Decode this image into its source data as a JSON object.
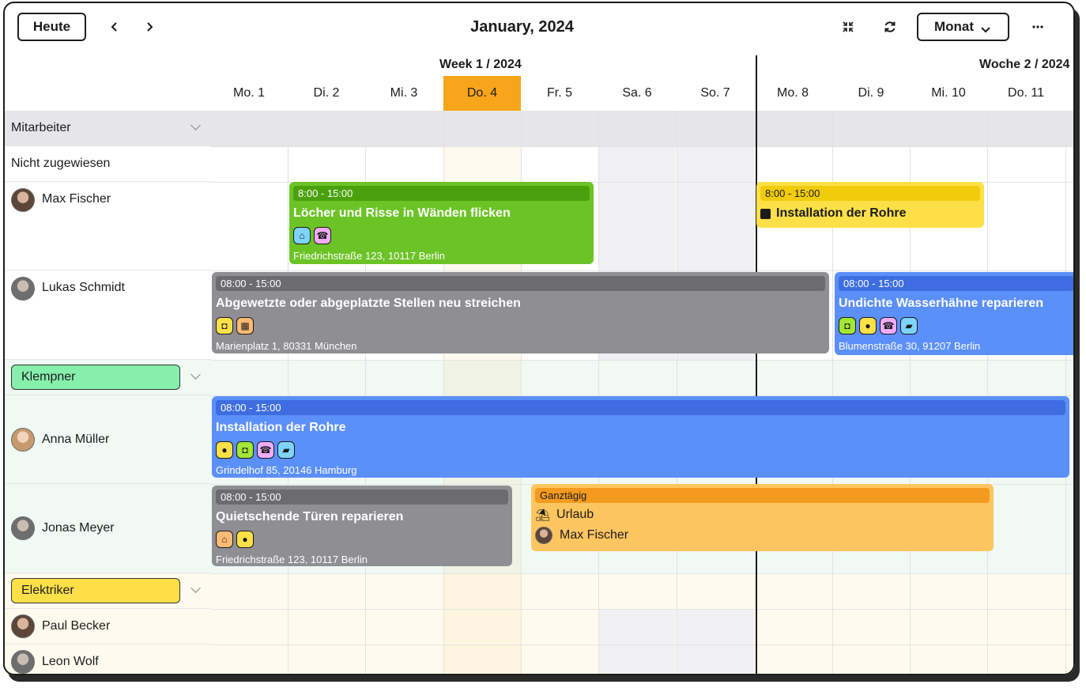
{
  "toolbar": {
    "today_label": "Heute",
    "prev_icon": "chevron-left-icon",
    "next_icon": "chevron-right-icon",
    "title": "January, 2024",
    "collapse_icon": "collapse-arrows-icon",
    "refresh_icon": "refresh-icon",
    "view_label": "Monat",
    "more_icon": "more-horizontal-icon"
  },
  "weeks": [
    {
      "label": "Week 1 / 2024"
    },
    {
      "label": "Woche 2 / 2024"
    }
  ],
  "days": [
    "Mo. 1",
    "Di. 2",
    "Mi. 3",
    "Do. 4",
    "Fr. 5",
    "Sa. 6",
    "So. 7",
    "Mo. 8",
    "Di. 9",
    "Mi. 10",
    "Do. 11"
  ],
  "today_index": 3,
  "rows": {
    "staff_group": "Mitarbeiter",
    "unassigned": "Nicht zugewiesen",
    "max": "Max Fischer",
    "lukas": "Lukas Schmidt",
    "plumber_group": "Klempner",
    "anna": "Anna Müller",
    "jonas": "Jonas Meyer",
    "electrician_group": "Elektriker",
    "paul": "Paul Becker",
    "leon": "Leon Wolf"
  },
  "colors": {
    "today": "#f7a51a",
    "plumber_group": "#86efac",
    "electrician_group": "#fde047",
    "green_event": "#6cc326",
    "gray_event": "#8e8e93",
    "blue_event": "#5b8ff9",
    "yellow_event": "#fde047",
    "orange_event": "#fdc55f"
  },
  "events": {
    "e1": {
      "time": "8:00 - 15:00",
      "title": "Löcher und Risse in Wänden flicken",
      "address": "Friedrichstraße 123, 10117 Berlin",
      "icons": [
        "home-icon",
        "phone-icon"
      ]
    },
    "e2": {
      "time": "8:00 - 15:00",
      "title": "Installation der Rohre",
      "icons": [
        "note-icon"
      ]
    },
    "e3": {
      "time": "08:00 - 15:00",
      "title": "Abgewetzte oder abgeplatzte Stellen neu streichen",
      "address": "Marienplatz 1, 80331 München",
      "icons": [
        "car-icon",
        "building-icon"
      ]
    },
    "e4": {
      "time": "08:00 - 15:00",
      "title": "Undichte Wasserhähne reparieren",
      "address": "Blumenstraße 30, 91207 Berlin",
      "icons": [
        "car-icon",
        "person-icon",
        "phone-icon",
        "truck-icon"
      ]
    },
    "e5": {
      "time": "08:00 - 15:00",
      "title": "Installation der Rohre",
      "address": "Grindelhof 85, 20146 Hamburg",
      "icons": [
        "person-icon",
        "car-icon",
        "phone-icon",
        "truck-icon"
      ]
    },
    "e6": {
      "time": "08:00 - 15:00",
      "title": "Quietschende Türen reparieren",
      "address": "Friedrichstraße 123, 10117 Berlin",
      "icons": [
        "home-icon",
        "person-icon"
      ]
    },
    "e7": {
      "time": "Ganztägig",
      "title": "Urlaub",
      "person": "Max Fischer",
      "icons": [
        "vacation-icon"
      ]
    }
  }
}
